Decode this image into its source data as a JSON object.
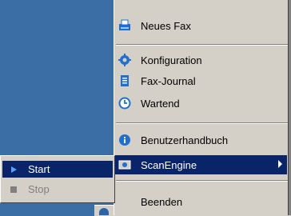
{
  "menu": {
    "items": [
      {
        "label": "Neues Fax",
        "icon": "fax-icon"
      },
      {
        "label": "Konfiguration",
        "icon": "gear-icon"
      },
      {
        "label": "Fax-Journal",
        "icon": "journal-icon"
      },
      {
        "label": "Wartend",
        "icon": "clock-icon"
      },
      {
        "label": "Benutzerhandbuch",
        "icon": "info-icon"
      },
      {
        "label": "ScanEngine",
        "icon": "scan-icon"
      },
      {
        "label": "Beenden"
      }
    ]
  },
  "submenu": {
    "items": [
      {
        "label": "Start",
        "icon": "play-icon"
      },
      {
        "label": "Stop",
        "icon": "stop-icon"
      }
    ]
  },
  "colors": {
    "desktop": "#3b6ea5",
    "menu_bg": "#d4d0c8",
    "selection": "#0a246a"
  }
}
